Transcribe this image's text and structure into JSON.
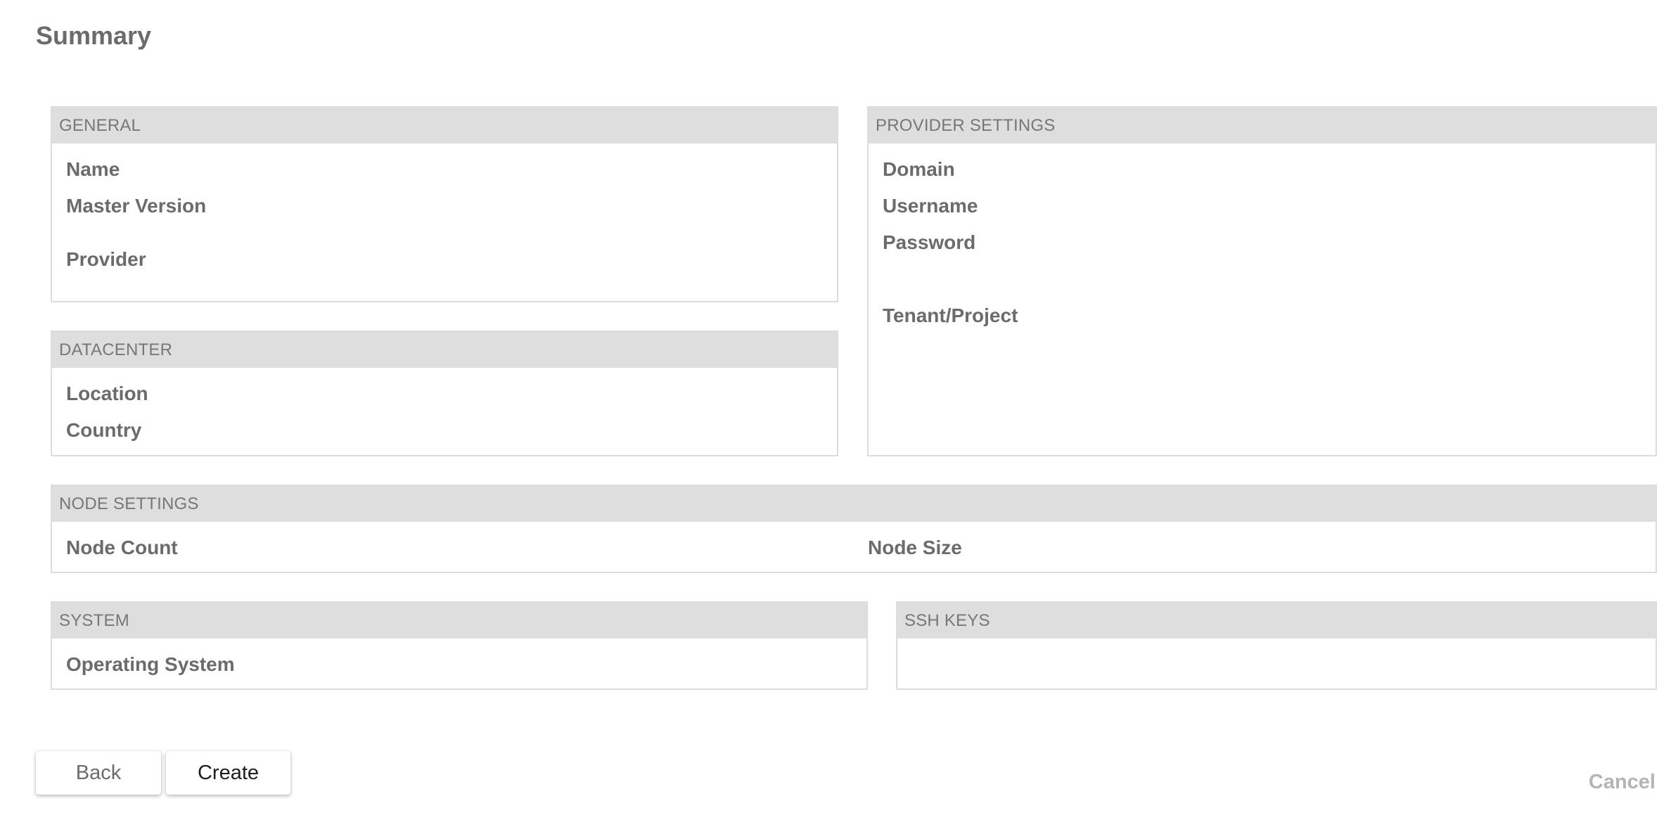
{
  "page": {
    "title": "Summary"
  },
  "general": {
    "header": "GENERAL",
    "fields": {
      "name": "Name",
      "master_version": "Master Version",
      "provider": "Provider"
    }
  },
  "datacenter": {
    "header": "DATACENTER",
    "fields": {
      "location": "Location",
      "country": "Country"
    }
  },
  "provider_settings": {
    "header": "PROVIDER SETTINGS",
    "fields": {
      "domain": "Domain",
      "username": "Username",
      "password": "Password",
      "tenant_project": "Tenant/Project"
    }
  },
  "node_settings": {
    "header": "NODE SETTINGS",
    "fields": {
      "node_count": "Node Count",
      "node_size": "Node Size"
    }
  },
  "system": {
    "header": "SYSTEM",
    "fields": {
      "operating_system": "Operating System"
    }
  },
  "ssh_keys": {
    "header": "SSH KEYS"
  },
  "actions": {
    "back_label": "Back",
    "create_label": "Create",
    "cancel_label": "Cancel"
  },
  "colors": {
    "header_bg": "#dedede",
    "text": "#6b6b6b",
    "border": "#dcdcdc",
    "cancel": "#b5b5b5"
  }
}
